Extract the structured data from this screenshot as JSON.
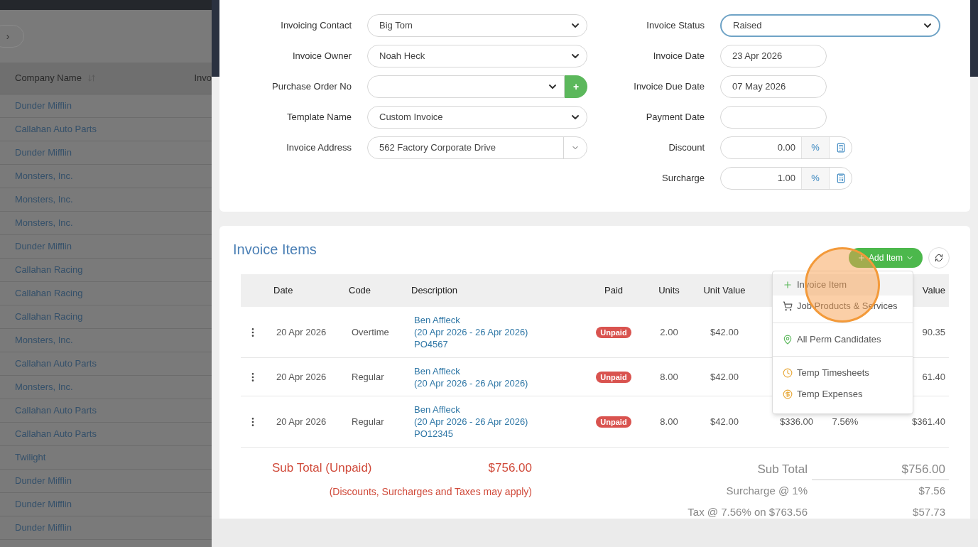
{
  "background_list": {
    "nav_button": "›",
    "columns": [
      "Company Name",
      "Invo"
    ],
    "rows": [
      "Dunder Mifflin",
      "Callahan Auto Parts",
      "Dunder Mifflin",
      "Monsters, Inc.",
      "Monsters, Inc.",
      "Monsters, Inc.",
      "Dunder Mifflin",
      "Callahan Racing",
      "Callahan Racing",
      "Callahan Racing",
      "Monsters, Inc.",
      "Callahan Auto Parts",
      "Monsters, Inc.",
      "Callahan Auto Parts",
      "Callahan Auto Parts",
      "Twilight",
      "Dunder Mifflin",
      "Dunder Mifflin",
      "Dunder Mifflin"
    ]
  },
  "invoice_form": {
    "left_fields": [
      {
        "label": "Invoicing Contact",
        "value": "Big Tom",
        "kind": "select"
      },
      {
        "label": "Invoice Owner",
        "value": "Noah Heck",
        "kind": "select"
      },
      {
        "label": "Purchase Order No",
        "kind": "select_add",
        "button": "+"
      },
      {
        "label": "Template Name",
        "value": "Custom Invoice",
        "kind": "select"
      },
      {
        "label": "Invoice Address",
        "value": "562 Factory Corporate Drive",
        "kind": "address"
      }
    ],
    "right_fields": [
      {
        "label": "Invoice Status",
        "value": "Raised",
        "kind": "select",
        "focused": true
      },
      {
        "label": "Invoice Date",
        "value": "23 Apr 2026",
        "kind": "date"
      },
      {
        "label": "Invoice Due Date",
        "value": "07 May 2026",
        "kind": "date"
      },
      {
        "label": "Payment Date",
        "kind": "date"
      },
      {
        "label": "Discount",
        "value": "0.00",
        "kind": "percent",
        "unit": "%"
      },
      {
        "label": "Surcharge",
        "value": "1.00",
        "kind": "percent",
        "unit": "%"
      }
    ]
  },
  "invoice_items": {
    "title": "Invoice Items",
    "add_button": "Add Item",
    "columns": [
      "Date",
      "Code",
      "Description",
      "Paid",
      "Units",
      "Unit Value",
      "Value"
    ],
    "rows": [
      {
        "date": "20 Apr 2026",
        "code": "Overtime",
        "description": [
          "Ben Affleck",
          "(20 Apr 2026 - 26 Apr 2026)",
          "PO4567"
        ],
        "paid": "Unpaid",
        "units": "2.00",
        "unit_value": "$42.00",
        "value": "90.35"
      },
      {
        "date": "20 Apr 2026",
        "code": "Regular",
        "description": [
          "Ben Affleck",
          "(20 Apr 2026 - 26 Apr 2026)"
        ],
        "paid": "Unpaid",
        "units": "8.00",
        "unit_value": "$42.00",
        "value": "61.40"
      },
      {
        "date": "20 Apr 2026",
        "code": "Regular",
        "description": [
          "Ben Affleck",
          "(20 Apr 2026 - 26 Apr 2026)",
          "PO12345"
        ],
        "paid": "Unpaid",
        "units": "8.00",
        "unit_value": "$42.00",
        "net": "$336.00",
        "tax": "7.56%",
        "value": "$361.40"
      }
    ],
    "unpaid_subtotal": {
      "label": "Sub Total (Unpaid)",
      "value": "$756.00",
      "note": "(Discounts, Surcharges and Taxes may apply)"
    },
    "totals": [
      {
        "label": "Sub Total",
        "value": "$756.00",
        "kind": "main"
      },
      {
        "label": "Surcharge @ 1%",
        "value": "$7.56",
        "kind": "line"
      },
      {
        "label": "Tax @ 7.56% on $763.56",
        "value": "$57.73",
        "kind": "line"
      }
    ]
  },
  "add_item_menu": {
    "groups": [
      [
        {
          "label": "Invoice Item",
          "kind": "manual",
          "selected": true
        },
        {
          "label": "Job Products & Services",
          "kind": "product",
          "selected": false
        }
      ],
      [
        {
          "label": "All Perm Candidates",
          "kind": "placement",
          "selected": false
        }
      ],
      [
        {
          "label": "Temp Timesheets",
          "kind": "timesheet",
          "selected": false
        },
        {
          "label": "Temp Expenses",
          "kind": "expense",
          "selected": false
        }
      ]
    ]
  },
  "click_highlight": true
}
